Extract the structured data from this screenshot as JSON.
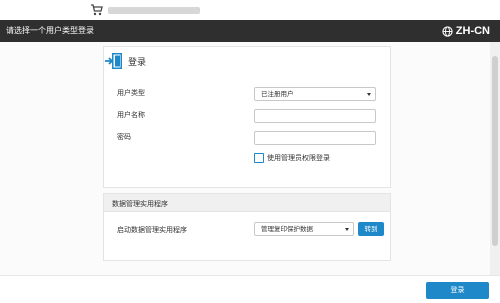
{
  "header": {
    "title": "请选择一个用户类型登录",
    "language": "ZH-CN"
  },
  "login": {
    "title": "登录",
    "user_type_label": "用户类型",
    "user_type_value": "已注册用户",
    "username_label": "用户名称",
    "username_value": "",
    "password_label": "密码",
    "password_value": "",
    "admin_checkbox_label": "使用管理员权限登录",
    "admin_checkbox_checked": false
  },
  "utility": {
    "section_title": "数据管理实用程序",
    "launch_label": "启动数据管理实用程序",
    "selected_utility": "管理复印保护数据",
    "goto_label": "转到"
  },
  "footer": {
    "login_button_label": "登录"
  },
  "colors": {
    "accent": "#1e88c8",
    "titlebar": "#2f2f2f"
  },
  "icons": {
    "top_logo": "printer-cart-icon",
    "language": "globe-icon",
    "login": "login-door-icon"
  }
}
